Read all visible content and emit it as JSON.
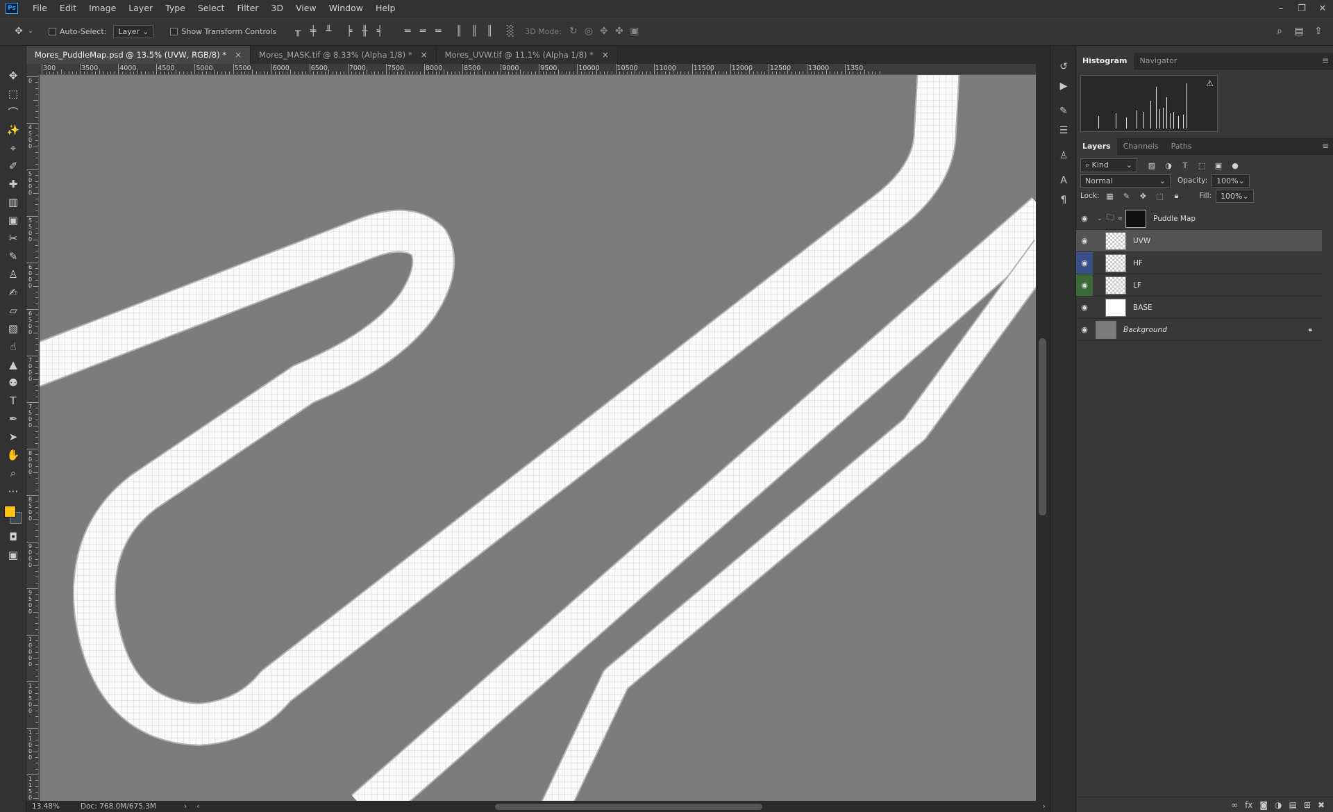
{
  "app": {
    "logo": "Ps"
  },
  "menu": [
    "File",
    "Edit",
    "Image",
    "Layer",
    "Type",
    "Select",
    "Filter",
    "3D",
    "View",
    "Window",
    "Help"
  ],
  "options": {
    "auto_select_label": "Auto-Select:",
    "auto_select_target": "Layer",
    "show_transform_label": "Show Transform Controls",
    "mode_3d_label": "3D Mode:"
  },
  "tabs": [
    {
      "label": "Mores_PuddleMap.psd @ 13.5% (UVW, RGB/8) *",
      "active": true
    },
    {
      "label": "Mores_MASK.tif @ 8.33% (Alpha 1/8) *",
      "active": false
    },
    {
      "label": "Mores_UVW.tif @ 11.1% (Alpha 1/8) *",
      "active": false
    }
  ],
  "ruler": {
    "h_labels": [
      "300",
      "3500",
      "4000",
      "4500",
      "5000",
      "5500",
      "6000",
      "6500",
      "7000",
      "7500",
      "8000",
      "8500",
      "9000",
      "9500",
      "10000",
      "10500",
      "11000",
      "11500",
      "12000",
      "12500",
      "13000",
      "1350"
    ],
    "v_labels": [
      "0",
      "4500",
      "5000",
      "5500",
      "6000",
      "6500",
      "7000",
      "7500",
      "8000",
      "8500",
      "9000",
      "9500",
      "10000",
      "10500",
      "11000",
      "11500"
    ]
  },
  "status": {
    "zoom": "13.48%",
    "doc": "Doc: 768.0M/675.3M"
  },
  "histogram_tabs": [
    {
      "label": "Histogram",
      "active": true
    },
    {
      "label": "Navigator",
      "active": false
    }
  ],
  "layers_tabs": [
    {
      "label": "Layers",
      "active": true
    },
    {
      "label": "Channels",
      "active": false
    },
    {
      "label": "Paths",
      "active": false
    }
  ],
  "layers_panel": {
    "filter_kind": "Kind",
    "blend_mode": "Normal",
    "opacity_label": "Opacity:",
    "opacity": "100%",
    "lock_label": "Lock:",
    "fill_label": "Fill:",
    "fill": "100%"
  },
  "layers": [
    {
      "name": "Puddle Map",
      "type": "group",
      "eye_color": ""
    },
    {
      "name": "UVW",
      "type": "checker",
      "selected": true,
      "eye_color": ""
    },
    {
      "name": "HF",
      "type": "checker",
      "eye_color": "#3a4f8a"
    },
    {
      "name": "LF",
      "type": "checker",
      "eye_color": "#3c6a37"
    },
    {
      "name": "BASE",
      "type": "white",
      "eye_color": ""
    },
    {
      "name": "Background",
      "type": "grey",
      "italic": true,
      "locked": true,
      "eye_color": ""
    }
  ],
  "colors": {
    "foreground": "#ffc20e",
    "background": "#3a4a52",
    "canvas": "#7c7c7c",
    "road": "#fbfbfb"
  }
}
